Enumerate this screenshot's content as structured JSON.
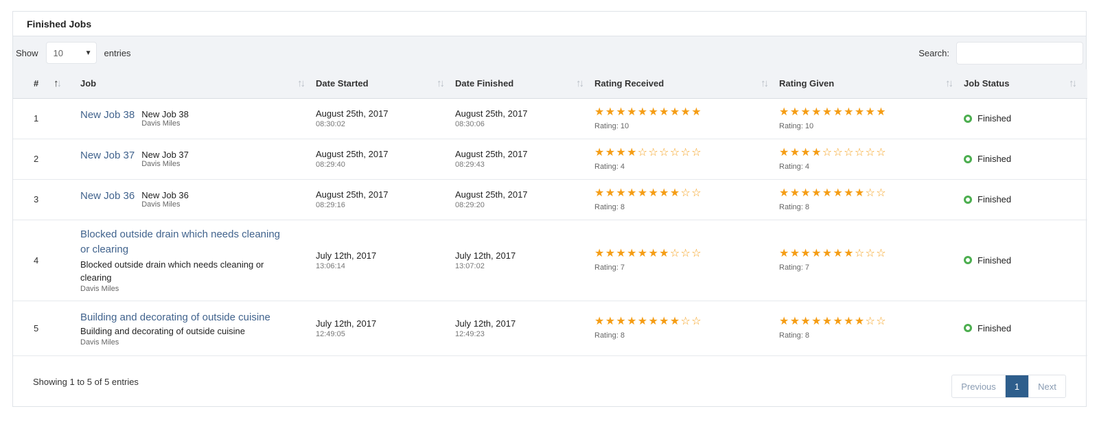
{
  "card": {
    "title": "Finished Jobs"
  },
  "toolbar": {
    "show_label": "Show",
    "page_size": "10",
    "entries_label": "entries",
    "search_label": "Search:",
    "search_value": ""
  },
  "columns": [
    "#",
    "Job",
    "Date Started",
    "Date Finished",
    "Rating Received",
    "Rating Given",
    "Job Status"
  ],
  "rows": [
    {
      "num": "1",
      "job_title": "New Job 38",
      "job_name": "New Job 38",
      "owner": "Davis Miles",
      "started_date": "August 25th, 2017",
      "started_time": "08:30:02",
      "finished_date": "August 25th, 2017",
      "finished_time": "08:30:06",
      "rating_received": 10,
      "rating_received_label": "Rating: 10",
      "rating_given": 10,
      "rating_given_label": "Rating: 10",
      "status": "Finished"
    },
    {
      "num": "2",
      "job_title": "New Job 37",
      "job_name": "New Job 37",
      "owner": "Davis Miles",
      "started_date": "August 25th, 2017",
      "started_time": "08:29:40",
      "finished_date": "August 25th, 2017",
      "finished_time": "08:29:43",
      "rating_received": 4,
      "rating_received_label": "Rating: 4",
      "rating_given": 4,
      "rating_given_label": "Rating: 4",
      "status": "Finished"
    },
    {
      "num": "3",
      "job_title": "New Job 36",
      "job_name": "New Job 36",
      "owner": "Davis Miles",
      "started_date": "August 25th, 2017",
      "started_time": "08:29:16",
      "finished_date": "August 25th, 2017",
      "finished_time": "08:29:20",
      "rating_received": 8,
      "rating_received_label": "Rating: 8",
      "rating_given": 8,
      "rating_given_label": "Rating: 8",
      "status": "Finished"
    },
    {
      "num": "4",
      "job_title": "Blocked outside drain which needs cleaning or clearing",
      "job_name": "Blocked outside drain which needs cleaning or clearing",
      "owner": "Davis Miles",
      "started_date": "July 12th, 2017",
      "started_time": "13:06:14",
      "finished_date": "July 12th, 2017",
      "finished_time": "13:07:02",
      "rating_received": 7,
      "rating_received_label": "Rating: 7",
      "rating_given": 7,
      "rating_given_label": "Rating: 7",
      "status": "Finished"
    },
    {
      "num": "5",
      "job_title": "Building and decorating of outside cuisine",
      "job_name": "Building and decorating of outside cuisine",
      "owner": "Davis Miles",
      "started_date": "July 12th, 2017",
      "started_time": "12:49:05",
      "finished_date": "July 12th, 2017",
      "finished_time": "12:49:23",
      "rating_received": 8,
      "rating_received_label": "Rating: 8",
      "rating_given": 8,
      "rating_given_label": "Rating: 8",
      "status": "Finished"
    }
  ],
  "footer": {
    "info": "Showing 1 to 5 of 5 entries",
    "prev_label": "Previous",
    "current_page": "1",
    "next_label": "Next"
  },
  "colors": {
    "star": "#f59d15",
    "status_ring": "#4cae4f",
    "link": "#41638d",
    "active_page": "#2e5e8c"
  }
}
